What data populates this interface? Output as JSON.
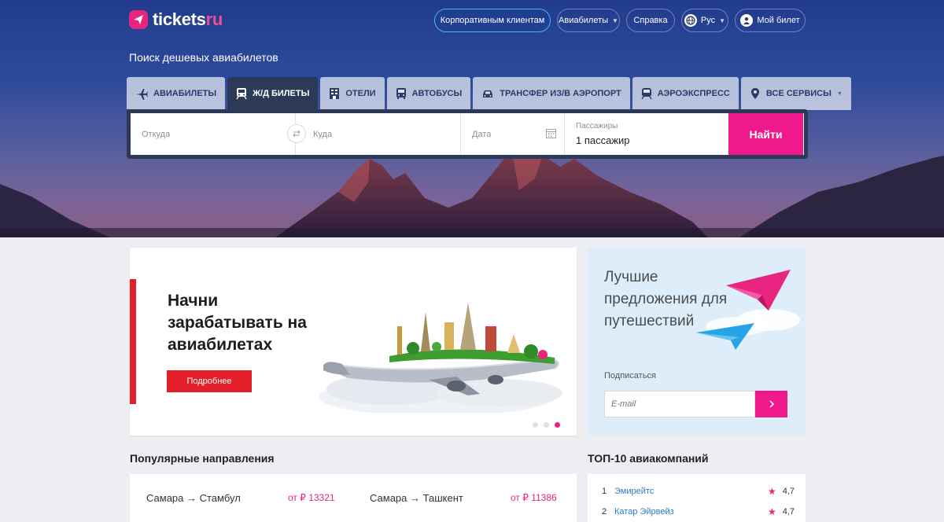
{
  "header": {
    "logo": {
      "main": "tickets",
      "accent": "ru"
    },
    "corporate_label": "Корпоративным клиентам",
    "flights_menu_label": "Авиабилеты",
    "help_label": "Справка",
    "language_label": "Рус",
    "my_ticket_label": "Мой билет"
  },
  "hero": {
    "subtitle": "Поиск дешевых авиабилетов"
  },
  "tabs": [
    {
      "label": "АВИАБИЛЕТЫ",
      "icon": "airplane-icon",
      "active": false
    },
    {
      "label": "Ж/Д БИЛЕТЫ",
      "icon": "train-icon",
      "active": true
    },
    {
      "label": "ОТЕЛИ",
      "icon": "hotel-icon",
      "active": false
    },
    {
      "label": "АВТОБУСЫ",
      "icon": "bus-icon",
      "active": false
    },
    {
      "label": "ТРАНСФЕР ИЗ/В АЭРОПОРТ",
      "icon": "car-icon",
      "active": false
    },
    {
      "label": "АЭРОЭКСПРЕСС",
      "icon": "aeroexpress-icon",
      "active": false
    },
    {
      "label": "ВСЕ СЕРВИСЫ",
      "icon": "map-pin-icon",
      "active": false
    }
  ],
  "search": {
    "from_placeholder": "Откуда",
    "to_placeholder": "Куда",
    "date_placeholder": "Дата",
    "passengers_label": "Пассажиры",
    "passengers_value": "1 пассажир",
    "submit_label": "Найти"
  },
  "banner": {
    "headline": "Начни зарабатывать на авиабилетах",
    "button_label": "Подробнее",
    "slides_total": 3,
    "active_slide": 3
  },
  "subscribe": {
    "title": "Лучшие предложения для путешествий",
    "label": "Подписаться",
    "email_placeholder": "E-mail",
    "submit_icon": "chevron-right-icon"
  },
  "popular": {
    "title": "Популярные направления",
    "routes": [
      {
        "route": "Самара → Стамбул",
        "price": "от  ₽  13321"
      },
      {
        "route": "Самара → Ташкент",
        "price": "от  ₽  11386"
      }
    ]
  },
  "top_airlines": {
    "title": "ТОП-10 авиакомпаний",
    "items": [
      {
        "rank": "1",
        "name": "Эмирейтс",
        "rating": "4,7"
      },
      {
        "rank": "2",
        "name": "Катар Эйрвейз",
        "rating": "4,7"
      }
    ]
  },
  "colors": {
    "accent": "#f0188d",
    "search_bar": "#2c3a58",
    "banner_red": "#e3202a",
    "link": "#2a7bc7"
  }
}
